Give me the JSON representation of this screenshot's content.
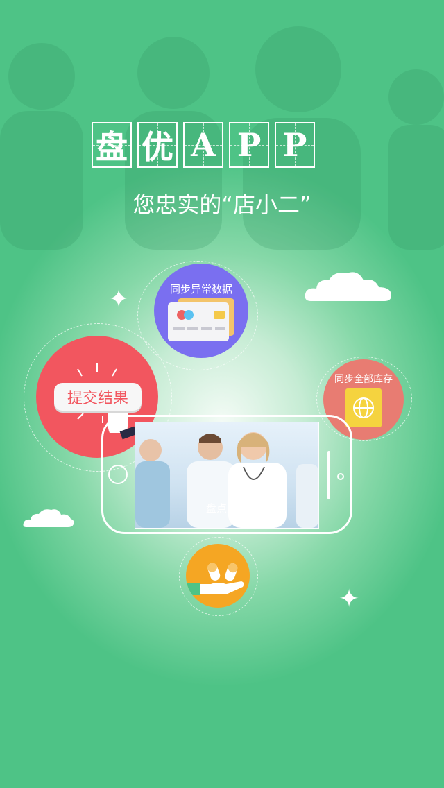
{
  "app": {
    "title_chars": [
      "盘",
      "优",
      "A",
      "P",
      "P"
    ],
    "subtitle": "您忠实的“店小二”"
  },
  "features": {
    "sync_abnormal": {
      "label": "同步异常数据",
      "color": "#7a6ff0"
    },
    "submit_result": {
      "label": "提交结果",
      "color": "#f2565f"
    },
    "sync_inventory": {
      "label": "同步全部库存",
      "color": "#e87c72"
    },
    "medicine_hand": {
      "color": "#f5a623"
    }
  },
  "phone": {
    "caption": "盘点药品"
  },
  "colors": {
    "primary_green": "#4ec386"
  }
}
